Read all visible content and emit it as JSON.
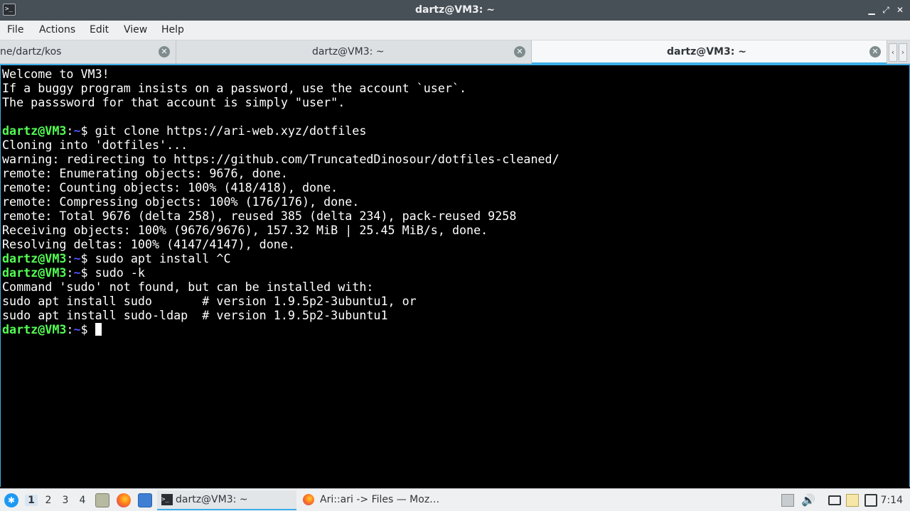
{
  "window": {
    "title": "dartz@VM3: ~",
    "controls": {
      "minimize": "▁",
      "maximize": "⤢",
      "close": "✕"
    }
  },
  "menu": [
    "File",
    "Actions",
    "Edit",
    "View",
    "Help"
  ],
  "tabs": [
    {
      "label": "ne/dartz/kos",
      "active": false
    },
    {
      "label": "dartz@VM3: ~",
      "active": false
    },
    {
      "label": "dartz@VM3: ~",
      "active": true
    }
  ],
  "tab_scroll": {
    "left": "‹",
    "right": "›"
  },
  "terminal": {
    "prompt_user": "dartz@VM3",
    "prompt_path": "~",
    "prompt_suffix": "$ ",
    "lines": [
      {
        "type": "text",
        "text": "Welcome to VM3!"
      },
      {
        "type": "text",
        "text": "If a buggy program insists on a password, use the account `user`."
      },
      {
        "type": "text",
        "text": "The passsword for that account is simply \"user\"."
      },
      {
        "type": "text",
        "text": ""
      },
      {
        "type": "prompt",
        "text": "git clone https://ari-web.xyz/dotfiles"
      },
      {
        "type": "text",
        "text": "Cloning into 'dotfiles'..."
      },
      {
        "type": "text",
        "text": "warning: redirecting to https://github.com/TruncatedDinosour/dotfiles-cleaned/"
      },
      {
        "type": "text",
        "text": "remote: Enumerating objects: 9676, done."
      },
      {
        "type": "text",
        "text": "remote: Counting objects: 100% (418/418), done."
      },
      {
        "type": "text",
        "text": "remote: Compressing objects: 100% (176/176), done."
      },
      {
        "type": "text",
        "text": "remote: Total 9676 (delta 258), reused 385 (delta 234), pack-reused 9258"
      },
      {
        "type": "text",
        "text": "Receiving objects: 100% (9676/9676), 157.32 MiB | 25.45 MiB/s, done."
      },
      {
        "type": "text",
        "text": "Resolving deltas: 100% (4147/4147), done."
      },
      {
        "type": "prompt",
        "text": "sudo apt install ^C"
      },
      {
        "type": "prompt",
        "text": "sudo -k"
      },
      {
        "type": "text",
        "text": "Command 'sudo' not found, but can be installed with:"
      },
      {
        "type": "text",
        "text": "sudo apt install sudo       # version 1.9.5p2-3ubuntu1, or"
      },
      {
        "type": "text",
        "text": "sudo apt install sudo-ldap  # version 1.9.5p2-3ubuntu1"
      },
      {
        "type": "prompt_cursor",
        "text": ""
      }
    ]
  },
  "taskbar": {
    "start_icon": "start-menu-icon",
    "desktops": [
      "1",
      "2",
      "3",
      "4"
    ],
    "active_desktop": "1",
    "quicklaunch": [
      "file-manager-icon",
      "firefox-icon",
      "desktop-icon"
    ],
    "tasks": [
      {
        "label": "dartz@VM3: ~",
        "icon": "terminal-icon",
        "active": true
      },
      {
        "label": "Ari::ari -> Files — Moz…",
        "icon": "firefox-icon",
        "active": false
      }
    ],
    "tray": [
      "updates-icon",
      "volume-icon",
      "keyboard-icon",
      "clipboard-icon",
      "screen-icon"
    ],
    "clock": "7:14"
  },
  "colors": {
    "prompt_user": "#54ff54",
    "prompt_path": "#5454ff",
    "accent": "#3daee9",
    "titlebar": "#475057"
  }
}
